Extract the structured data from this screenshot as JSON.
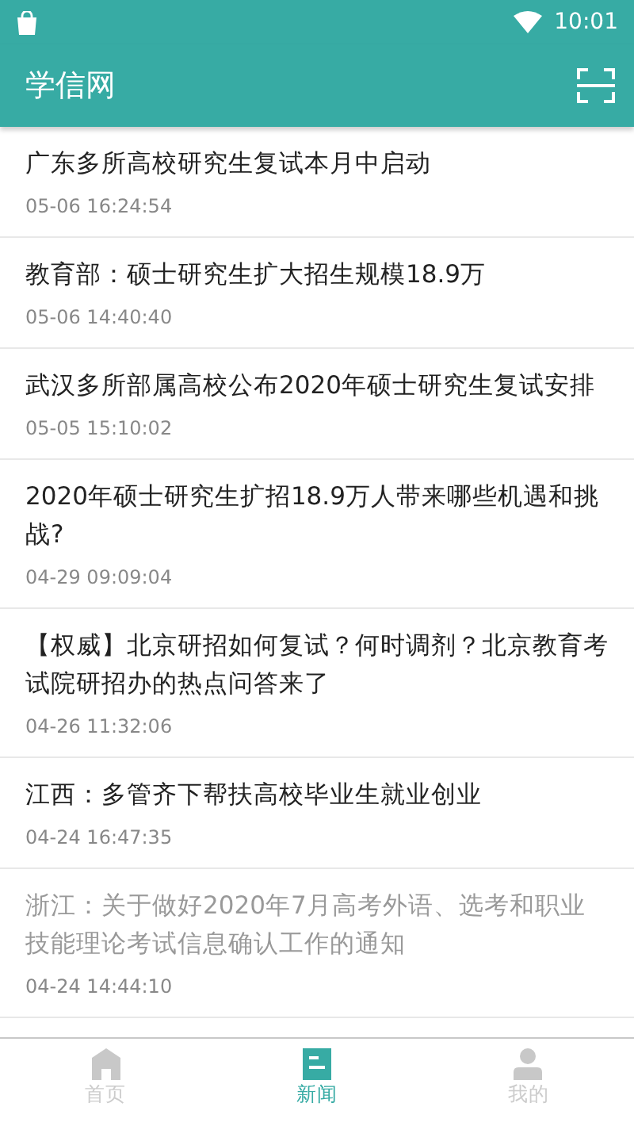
{
  "status_bar": {
    "time": "10:01"
  },
  "header": {
    "title": "学信网"
  },
  "news": [
    {
      "title": "广东多所高校研究生复试本月中启动",
      "time": "05-06 16:24:54",
      "read": false
    },
    {
      "title": "教育部：硕士研究生扩大招生规模18.9万",
      "time": "05-06 14:40:40",
      "read": false
    },
    {
      "title": "武汉多所部属高校公布2020年硕士研究生复试安排",
      "time": "05-05 15:10:02",
      "read": false
    },
    {
      "title": "2020年硕士研究生扩招18.9万人带来哪些机遇和挑战?",
      "time": "04-29 09:09:04",
      "read": false
    },
    {
      "title": "【权威】北京研招如何复试？何时调剂？北京教育考试院研招办的热点问答来了",
      "time": "04-26 11:32:06",
      "read": false
    },
    {
      "title": "江西：多管齐下帮扶高校毕业生就业创业",
      "time": "04-24 16:47:35",
      "read": false
    },
    {
      "title": "浙江：关于做好2020年7月高考外语、选考和职业技能理论考试信息确认工作的通知",
      "time": "04-24 14:44:10",
      "read": true
    }
  ],
  "bottom_nav": [
    {
      "label": "首页",
      "kind": "home",
      "selected": false
    },
    {
      "label": "新闻",
      "kind": "news",
      "selected": true
    },
    {
      "label": "我的",
      "kind": "profile",
      "selected": false
    }
  ]
}
